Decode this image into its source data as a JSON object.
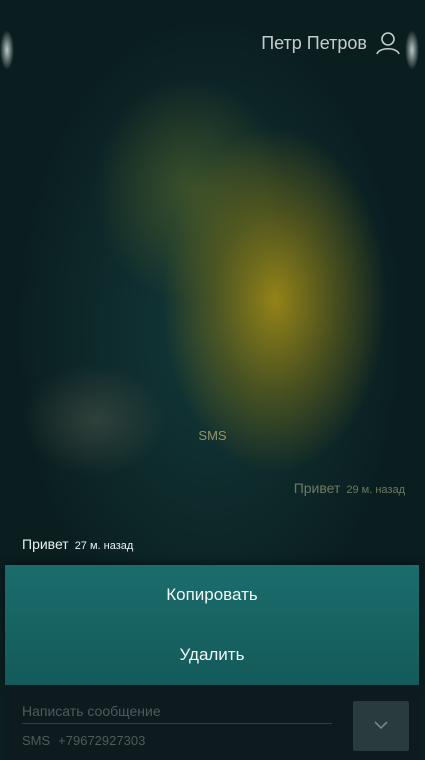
{
  "header": {
    "contact_name": "Петр Петров",
    "contact_icon": "person-icon"
  },
  "conversation": {
    "channel_label": "SMS",
    "messages": [
      {
        "direction": "incoming",
        "text": "Привет",
        "time": "29 м. назад"
      },
      {
        "direction": "outgoing",
        "text": "Привет",
        "time": "27 м. назад"
      }
    ]
  },
  "context_menu": {
    "copy_label": "Копировать",
    "delete_label": "Удалить"
  },
  "composer": {
    "placeholder": "Написать сообщение",
    "channel": "SMS",
    "phone": "+79672927303",
    "send_icon": "chevron-down-icon"
  },
  "colors": {
    "menu_background": "#1a6d6c",
    "composer_background": "#0e1a1e",
    "send_button": "#2a3b40"
  }
}
